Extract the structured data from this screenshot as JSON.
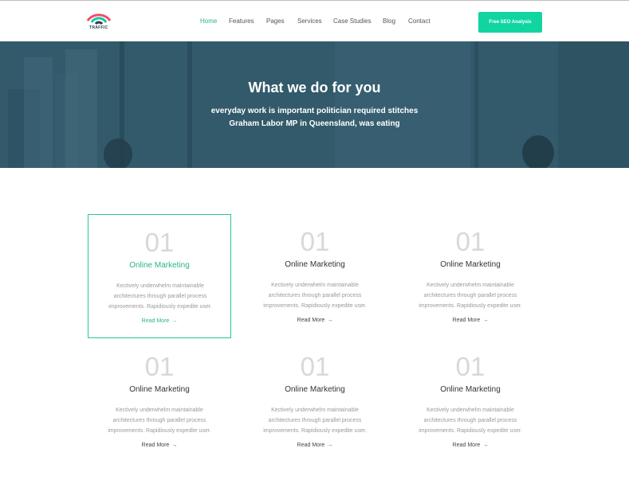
{
  "header": {
    "logo_text": "TRAFFIC",
    "nav": [
      {
        "label": "Home",
        "active": true
      },
      {
        "label": "Features",
        "active": false
      },
      {
        "label": "Pages",
        "active": false
      },
      {
        "label": "Services",
        "active": false
      },
      {
        "label": "Case Studies",
        "active": false
      },
      {
        "label": "Blog",
        "active": false
      },
      {
        "label": "Contact",
        "active": false
      }
    ],
    "cta_label": "Free SEO Analysis"
  },
  "hero": {
    "title": "What we do for you",
    "line1": "everyday work is important politician required stitches",
    "line2": "Graham Labor MP in Queensland, was eating"
  },
  "services": {
    "cards": [
      {
        "number": "01",
        "title": "Online Marketing",
        "desc": [
          "Kectively underwhelm maintainable",
          "architectures through parallel process",
          "improvements. Rapidiously expedite user."
        ],
        "link": "Read More",
        "highlight": true
      },
      {
        "number": "01",
        "title": "Online Marketing",
        "desc": [
          "Kectively underwhelm maintainable",
          "architectures through parallel process",
          "improvements. Rapidiously expedite user."
        ],
        "link": "Read More",
        "highlight": false
      },
      {
        "number": "01",
        "title": "Online Marketing",
        "desc": [
          "Kectively underwhelm maintainable",
          "architectures through parallel process",
          "improvements. Rapidiously expedite user."
        ],
        "link": "Read More",
        "highlight": false
      },
      {
        "number": "01",
        "title": "Online Marketing",
        "desc": [
          "Kectively underwhelm maintainable",
          "architectures through parallel process",
          "improvements. Rapidiously expedite user."
        ],
        "link": "Read More",
        "highlight": false
      },
      {
        "number": "01",
        "title": "Online Marketing",
        "desc": [
          "Kectively underwhelm maintainable",
          "architectures through parallel process",
          "improvements. Rapidiously expedite user."
        ],
        "link": "Read More",
        "highlight": false
      },
      {
        "number": "01",
        "title": "Online Marketing",
        "desc": [
          "Kectively underwhelm maintainable",
          "architectures through parallel process",
          "improvements. Rapidiously expedite user."
        ],
        "link": "Read More",
        "highlight": false
      }
    ]
  },
  "colors": {
    "accent": "#28b485",
    "cta": "#11d5a1",
    "hero_overlay": "#3b6578",
    "number": "#d8d8d8"
  },
  "icons": {
    "logo": "wifi-signal-icon",
    "read_more": "arrow-right-icon"
  }
}
